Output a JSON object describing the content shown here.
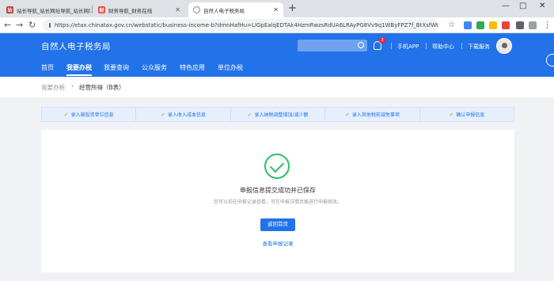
{
  "browser": {
    "tabs": [
      {
        "title": "站长导航_站长网址导航_站长网站"
      },
      {
        "title": "财务导航_财务在线"
      },
      {
        "title": "自然人电子税务局"
      }
    ],
    "new_tab": "+",
    "url": "https://etax.chinatax.gov.cn/webstatic/business-income-b?dmnHafHu=LIGpEalqEDTAk4HzmRwzsRdUA6LRAyPG8Vv9q1WByFPZ7f_BtXsfWtgE...",
    "window_controls": [
      "—",
      "□",
      "✕"
    ]
  },
  "header": {
    "site_title": "自然人电子税务局",
    "notification_count": "3",
    "links": {
      "mobile_app": "手机APP",
      "help": "帮助中心",
      "download": "下载服务"
    },
    "nav": [
      {
        "label": "首页"
      },
      {
        "label": "我要办税"
      },
      {
        "label": "我要查询"
      },
      {
        "label": "公众服务"
      },
      {
        "label": "特色应用"
      },
      {
        "label": "单位办税"
      }
    ]
  },
  "breadcrumb": {
    "parent": "我要办税",
    "separator": "›",
    "current": "经营所得（B表）"
  },
  "steps": [
    {
      "label": "录入被投资单位信息"
    },
    {
      "label": "录入收入成本信息"
    },
    {
      "label": "录入纳税调整增加/减少额"
    },
    {
      "label": "录入其他税前减免事项"
    },
    {
      "label": "确认申报信息"
    }
  ],
  "result": {
    "title": "申报信息提交成功并已保存",
    "subtitle": "您可以前往申报记录查看，可在申报详情页面进行申报修改。",
    "primary_button": "返回首页",
    "secondary_link": "查看申报记录"
  },
  "colors": {
    "brand_blue": "#2272e9",
    "success_green": "#2ebd6b",
    "step_bg": "#e6f0fd"
  }
}
